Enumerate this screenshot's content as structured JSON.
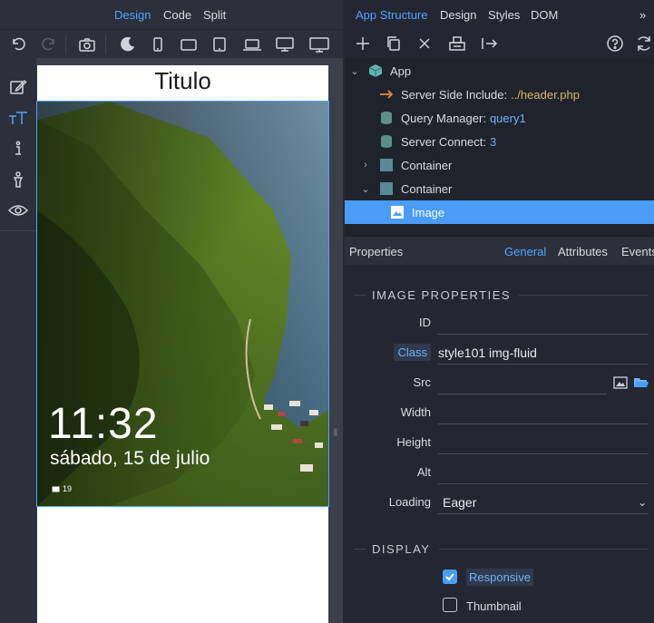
{
  "view_tabs": [
    "Design",
    "Code",
    "Split"
  ],
  "page": {
    "title": "Titulo",
    "lock_screen": {
      "time": "11:32",
      "date": "sábado, 15 de julio",
      "badge": "19"
    }
  },
  "panel_tabs": [
    "App Structure",
    "Design",
    "Styles",
    "DOM"
  ],
  "tree": {
    "app": "App",
    "ssi_label": "Server Side Include:",
    "ssi_value": "../header.php",
    "qm_label": "Query Manager:",
    "qm_value": "query1",
    "sc_label": "Server Connect:",
    "sc_value": "3",
    "container1": "Container",
    "container2": "Container",
    "image": "Image"
  },
  "properties": {
    "title": "Properties",
    "tabs": [
      "General",
      "Attributes",
      "Events"
    ],
    "section_image": "IMAGE PROPERTIES",
    "labels": {
      "id": "ID",
      "class": "Class",
      "src": "Src",
      "width": "Width",
      "height": "Height",
      "alt": "Alt",
      "loading": "Loading"
    },
    "values": {
      "id": "",
      "class": "style101 img-fluid",
      "src": "",
      "width": "",
      "height": "",
      "alt": "",
      "loading": "Eager"
    },
    "section_display": "DISPLAY",
    "responsive": "Responsive",
    "thumbnail": "Thumbnail"
  },
  "colors": {
    "accent": "#4a9cf5",
    "panel": "#232731",
    "tree_bg": "#1f232b"
  }
}
